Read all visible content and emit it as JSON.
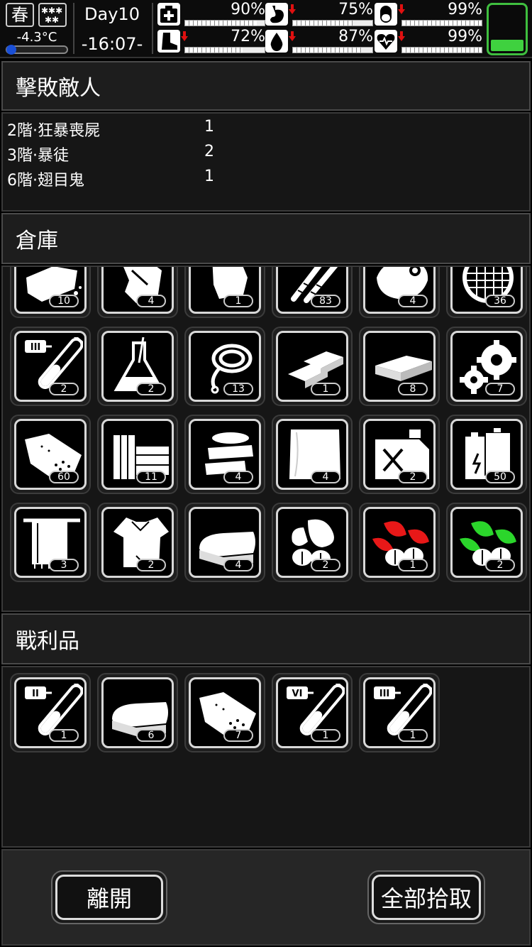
{
  "status": {
    "season": "春",
    "weather_icon": "snow-icon",
    "temperature": "-4.3°C",
    "temperature_level": 0.02,
    "day": "Day10",
    "clock": "-16:07-",
    "stats": [
      {
        "name": "health",
        "icon": "first-aid-icon",
        "value": "90%",
        "level": 0.9,
        "arrow": false
      },
      {
        "name": "hunger",
        "icon": "stomach-icon",
        "value": "75%",
        "level": 0.75,
        "arrow": true
      },
      {
        "name": "medicine",
        "icon": "pill-icon",
        "value": "99%",
        "level": 0.99,
        "arrow": true
      },
      {
        "name": "stamina",
        "icon": "boot-icon",
        "value": "72%",
        "level": 0.72,
        "arrow": true
      },
      {
        "name": "thirst",
        "icon": "water-drop-icon",
        "value": "87%",
        "level": 0.87,
        "arrow": true
      },
      {
        "name": "mood",
        "icon": "heart-icon",
        "value": "99%",
        "level": 0.99,
        "arrow": true
      }
    ],
    "battery_level": 0.25,
    "arrow_color": "#e01010",
    "battery_color": "#3fd13f"
  },
  "enemies": {
    "title": "擊敗敵人",
    "rows": [
      {
        "name": "2階·狂暴喪屍",
        "count": "1"
      },
      {
        "name": "3階·暴徒",
        "count": "2"
      },
      {
        "name": "6階·翅目鬼",
        "count": "1"
      }
    ]
  },
  "storage": {
    "title": "倉庫",
    "items": [
      {
        "icon": "bread-icon",
        "count": "10"
      },
      {
        "icon": "cloth-scrap-icon",
        "count": "4"
      },
      {
        "icon": "bloody-rag-icon",
        "count": "1"
      },
      {
        "icon": "screws-icon",
        "count": "83"
      },
      {
        "icon": "raw-meat-icon",
        "count": "4"
      },
      {
        "icon": "mesh-filter-icon",
        "count": "36"
      },
      {
        "icon": "test-tube-iii-icon",
        "count": "2"
      },
      {
        "icon": "flask-icon",
        "count": "2"
      },
      {
        "icon": "rope-icon",
        "count": "13"
      },
      {
        "icon": "metal-ingot-icon",
        "count": "1"
      },
      {
        "icon": "cash-stack-icon",
        "count": "8"
      },
      {
        "icon": "gears-icon",
        "count": "7"
      },
      {
        "icon": "dried-meat-icon",
        "count": "60"
      },
      {
        "icon": "wood-planks-icon",
        "count": "11"
      },
      {
        "icon": "bandage-roll-icon",
        "count": "4"
      },
      {
        "icon": "cloth-sheet-icon",
        "count": "4"
      },
      {
        "icon": "fuel-can-icon",
        "count": "2"
      },
      {
        "icon": "batteries-icon",
        "count": "50"
      },
      {
        "icon": "towel-icon",
        "count": "3"
      },
      {
        "icon": "torn-shirt-icon",
        "count": "2"
      },
      {
        "icon": "folded-cloth-icon",
        "count": "4"
      },
      {
        "icon": "seeds-icon",
        "count": "2"
      },
      {
        "icon": "red-herb-icon",
        "count": "1"
      },
      {
        "icon": "green-herb-icon",
        "count": "2"
      }
    ]
  },
  "loot": {
    "title": "戰利品",
    "items": [
      {
        "icon": "test-tube-ii-icon",
        "count": "1"
      },
      {
        "icon": "folded-cloth-icon",
        "count": "6"
      },
      {
        "icon": "dried-meat-icon",
        "count": "7"
      },
      {
        "icon": "test-tube-vi-icon",
        "count": "1"
      },
      {
        "icon": "test-tube-iii-icon",
        "count": "1"
      }
    ]
  },
  "buttons": {
    "leave": "離開",
    "take_all": "全部拾取"
  }
}
